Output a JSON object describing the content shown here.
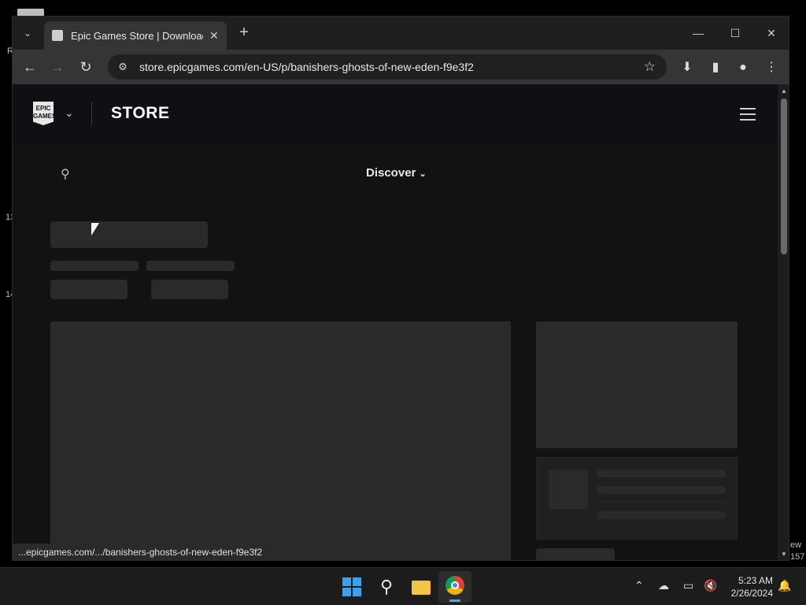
{
  "browser": {
    "tab_title": "Epic Games Store | Download &",
    "url": "store.epicgames.com/en-US/p/banishers-ghosts-of-new-eden-f9e3f2",
    "status_url": "...epicgames.com/.../banishers-ghosts-of-new-eden-f9e3f2"
  },
  "store": {
    "logo_text": "EPIC GAMES",
    "title": "STORE",
    "discover_label": "Discover"
  },
  "taskbar": {
    "time": "5:23 AM",
    "date": "2/26/2024"
  },
  "desktop": {
    "left_fragments": [
      "R",
      "13",
      "14"
    ],
    "right_fragments": [
      "ew",
      "157"
    ]
  },
  "colors": {
    "accent_blue": "#0078d4"
  }
}
